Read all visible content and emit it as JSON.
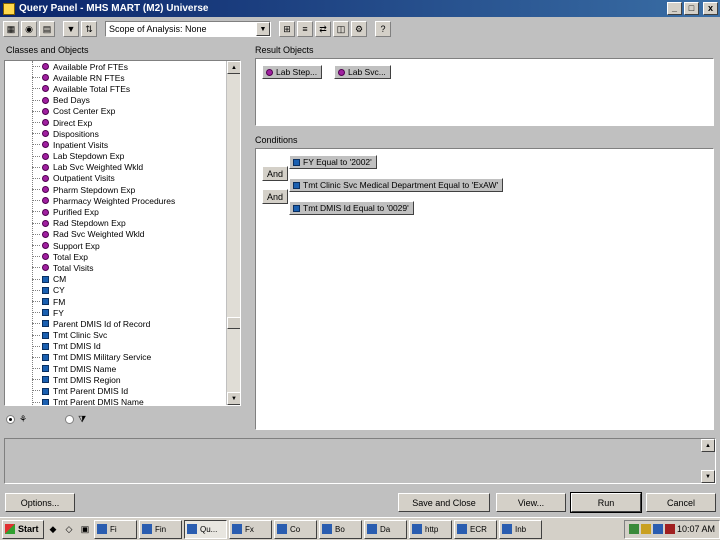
{
  "window": {
    "title": "Query Panel - MHS MART (M2) Universe",
    "minimize": "_",
    "maximize": "□",
    "close": "x"
  },
  "toolbar": {
    "combo_value": "Scope of Analysis: None"
  },
  "classes_label": "Classes and Objects",
  "tree_items": [
    {
      "label": "Available Prof FTEs",
      "icon": "measure"
    },
    {
      "label": "Available RN FTEs",
      "icon": "measure"
    },
    {
      "label": "Available Total FTEs",
      "icon": "measure"
    },
    {
      "label": "Bed Days",
      "icon": "measure"
    },
    {
      "label": "Cost Center Exp",
      "icon": "measure"
    },
    {
      "label": "Direct Exp",
      "icon": "measure"
    },
    {
      "label": "Dispositions",
      "icon": "measure"
    },
    {
      "label": "Inpatient Visits",
      "icon": "measure"
    },
    {
      "label": "Lab Stepdown Exp",
      "icon": "measure"
    },
    {
      "label": "Lab Svc Weighted Wkld",
      "icon": "measure"
    },
    {
      "label": "Outpatient Visits",
      "icon": "measure"
    },
    {
      "label": "Pharm Stepdown Exp",
      "icon": "measure"
    },
    {
      "label": "Pharmacy Weighted Procedures",
      "icon": "measure"
    },
    {
      "label": "Purified Exp",
      "icon": "measure"
    },
    {
      "label": "Rad Stepdown Exp",
      "icon": "measure"
    },
    {
      "label": "Rad Svc Weighted Wkld",
      "icon": "measure"
    },
    {
      "label": "Support Exp",
      "icon": "measure"
    },
    {
      "label": "Total Exp",
      "icon": "measure"
    },
    {
      "label": "Total Visits",
      "icon": "measure"
    },
    {
      "label": "CM",
      "icon": "dimension"
    },
    {
      "label": "CY",
      "icon": "dimension"
    },
    {
      "label": "FM",
      "icon": "dimension"
    },
    {
      "label": "FY",
      "icon": "dimension"
    },
    {
      "label": "Parent DMIS Id of Record",
      "icon": "dimension"
    },
    {
      "label": "Tmt Clinic Svc",
      "icon": "dimension"
    },
    {
      "label": "Tmt DMIS Id",
      "icon": "dimension"
    },
    {
      "label": "Tmt DMIS Military Service",
      "icon": "dimension"
    },
    {
      "label": "Tmt DMIS Name",
      "icon": "dimension"
    },
    {
      "label": "Tmt DMIS Region",
      "icon": "dimension"
    },
    {
      "label": "Tmt Parent DMIS Id",
      "icon": "dimension"
    },
    {
      "label": "Tmt Parent DMIS Name",
      "icon": "dimension"
    }
  ],
  "result_label": "Result Objects",
  "result_objects": [
    "Lab Step...",
    "Lab Svc..."
  ],
  "conditions_label": "Conditions",
  "and_labels": [
    "And",
    "And"
  ],
  "conditions": [
    "FY Equal to '2002'",
    "Tmt Clinic Svc Medical Department Equal to 'ExAW'",
    "Tmt DMIS Id Equal to '0029'"
  ],
  "buttons": {
    "options": "Options...",
    "save_close": "Save and Close",
    "view": "View...",
    "run": "Run",
    "cancel": "Cancel"
  },
  "taskbar": {
    "start": "Start",
    "items": [
      "Fi",
      "Fin",
      "Qu...",
      "Fx",
      "Co",
      "Bo",
      "Da",
      "http",
      "ECR",
      "Inb"
    ],
    "clock": "10:07 AM"
  },
  "colors": {
    "titlebar": "#0a246a",
    "measure_icon": "#a020a0",
    "dimension_icon": "#1a5fb0"
  }
}
